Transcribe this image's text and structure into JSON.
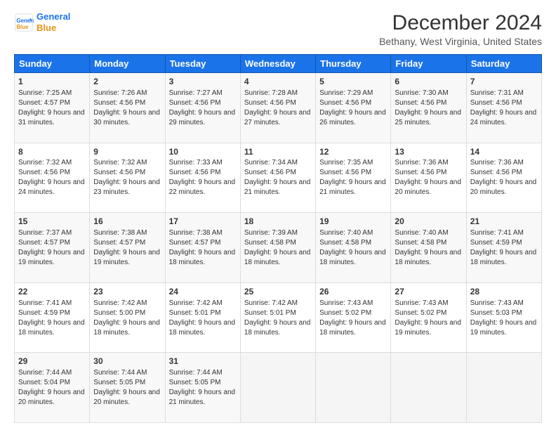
{
  "logo": {
    "line1": "General",
    "line2": "Blue"
  },
  "title": "December 2024",
  "subtitle": "Bethany, West Virginia, United States",
  "days_of_week": [
    "Sunday",
    "Monday",
    "Tuesday",
    "Wednesday",
    "Thursday",
    "Friday",
    "Saturday"
  ],
  "weeks": [
    [
      {
        "day": 1,
        "sunrise": "7:25 AM",
        "sunset": "4:57 PM",
        "daylight": "9 hours and 31 minutes."
      },
      {
        "day": 2,
        "sunrise": "7:26 AM",
        "sunset": "4:56 PM",
        "daylight": "9 hours and 30 minutes."
      },
      {
        "day": 3,
        "sunrise": "7:27 AM",
        "sunset": "4:56 PM",
        "daylight": "9 hours and 29 minutes."
      },
      {
        "day": 4,
        "sunrise": "7:28 AM",
        "sunset": "4:56 PM",
        "daylight": "9 hours and 27 minutes."
      },
      {
        "day": 5,
        "sunrise": "7:29 AM",
        "sunset": "4:56 PM",
        "daylight": "9 hours and 26 minutes."
      },
      {
        "day": 6,
        "sunrise": "7:30 AM",
        "sunset": "4:56 PM",
        "daylight": "9 hours and 25 minutes."
      },
      {
        "day": 7,
        "sunrise": "7:31 AM",
        "sunset": "4:56 PM",
        "daylight": "9 hours and 24 minutes."
      }
    ],
    [
      {
        "day": 8,
        "sunrise": "7:32 AM",
        "sunset": "4:56 PM",
        "daylight": "9 hours and 24 minutes."
      },
      {
        "day": 9,
        "sunrise": "7:32 AM",
        "sunset": "4:56 PM",
        "daylight": "9 hours and 23 minutes."
      },
      {
        "day": 10,
        "sunrise": "7:33 AM",
        "sunset": "4:56 PM",
        "daylight": "9 hours and 22 minutes."
      },
      {
        "day": 11,
        "sunrise": "7:34 AM",
        "sunset": "4:56 PM",
        "daylight": "9 hours and 21 minutes."
      },
      {
        "day": 12,
        "sunrise": "7:35 AM",
        "sunset": "4:56 PM",
        "daylight": "9 hours and 21 minutes."
      },
      {
        "day": 13,
        "sunrise": "7:36 AM",
        "sunset": "4:56 PM",
        "daylight": "9 hours and 20 minutes."
      },
      {
        "day": 14,
        "sunrise": "7:36 AM",
        "sunset": "4:56 PM",
        "daylight": "9 hours and 20 minutes."
      }
    ],
    [
      {
        "day": 15,
        "sunrise": "7:37 AM",
        "sunset": "4:57 PM",
        "daylight": "9 hours and 19 minutes."
      },
      {
        "day": 16,
        "sunrise": "7:38 AM",
        "sunset": "4:57 PM",
        "daylight": "9 hours and 19 minutes."
      },
      {
        "day": 17,
        "sunrise": "7:38 AM",
        "sunset": "4:57 PM",
        "daylight": "9 hours and 18 minutes."
      },
      {
        "day": 18,
        "sunrise": "7:39 AM",
        "sunset": "4:58 PM",
        "daylight": "9 hours and 18 minutes."
      },
      {
        "day": 19,
        "sunrise": "7:40 AM",
        "sunset": "4:58 PM",
        "daylight": "9 hours and 18 minutes."
      },
      {
        "day": 20,
        "sunrise": "7:40 AM",
        "sunset": "4:58 PM",
        "daylight": "9 hours and 18 minutes."
      },
      {
        "day": 21,
        "sunrise": "7:41 AM",
        "sunset": "4:59 PM",
        "daylight": "9 hours and 18 minutes."
      }
    ],
    [
      {
        "day": 22,
        "sunrise": "7:41 AM",
        "sunset": "4:59 PM",
        "daylight": "9 hours and 18 minutes."
      },
      {
        "day": 23,
        "sunrise": "7:42 AM",
        "sunset": "5:00 PM",
        "daylight": "9 hours and 18 minutes."
      },
      {
        "day": 24,
        "sunrise": "7:42 AM",
        "sunset": "5:01 PM",
        "daylight": "9 hours and 18 minutes."
      },
      {
        "day": 25,
        "sunrise": "7:42 AM",
        "sunset": "5:01 PM",
        "daylight": "9 hours and 18 minutes."
      },
      {
        "day": 26,
        "sunrise": "7:43 AM",
        "sunset": "5:02 PM",
        "daylight": "9 hours and 18 minutes."
      },
      {
        "day": 27,
        "sunrise": "7:43 AM",
        "sunset": "5:02 PM",
        "daylight": "9 hours and 19 minutes."
      },
      {
        "day": 28,
        "sunrise": "7:43 AM",
        "sunset": "5:03 PM",
        "daylight": "9 hours and 19 minutes."
      }
    ],
    [
      {
        "day": 29,
        "sunrise": "7:44 AM",
        "sunset": "5:04 PM",
        "daylight": "9 hours and 20 minutes."
      },
      {
        "day": 30,
        "sunrise": "7:44 AM",
        "sunset": "5:05 PM",
        "daylight": "9 hours and 20 minutes."
      },
      {
        "day": 31,
        "sunrise": "7:44 AM",
        "sunset": "5:05 PM",
        "daylight": "9 hours and 21 minutes."
      },
      null,
      null,
      null,
      null
    ]
  ]
}
